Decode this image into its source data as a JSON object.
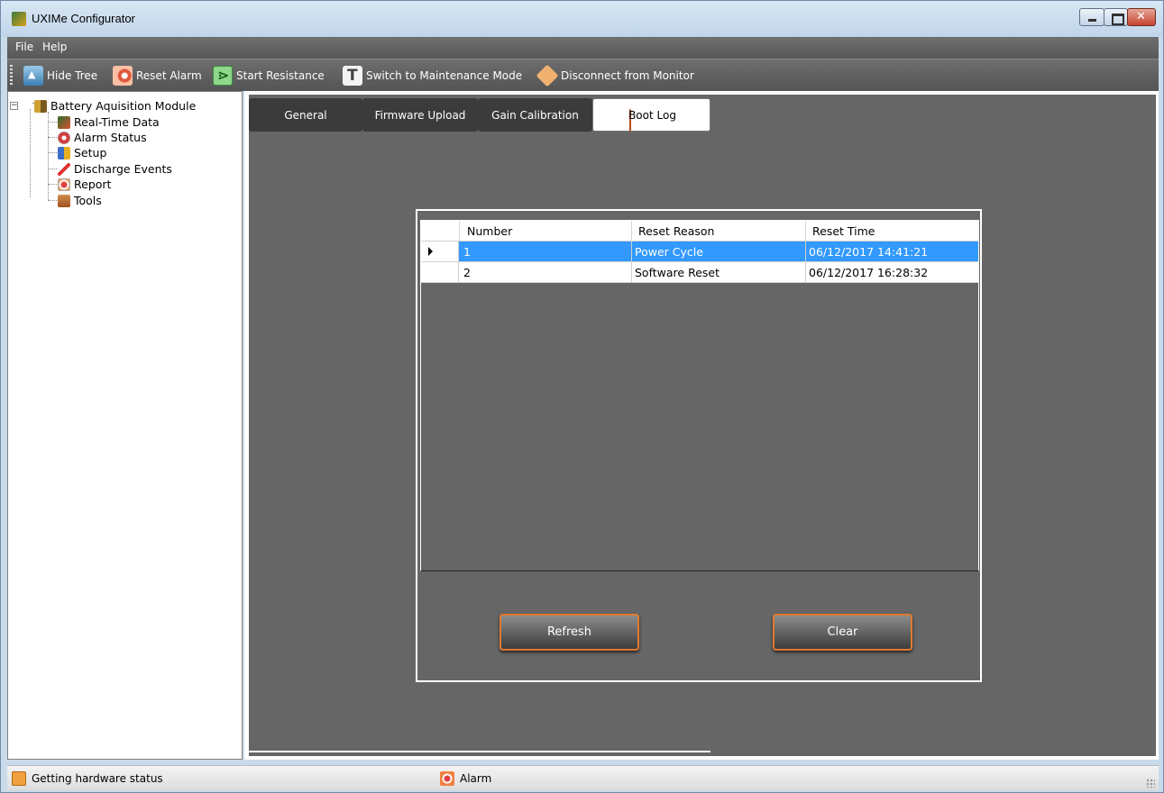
{
  "window": {
    "title": "UXIMe Configurator"
  },
  "menu": {
    "items": [
      "File",
      "Help"
    ]
  },
  "toolbar": {
    "hide_tree": "Hide Tree",
    "reset_alarm": "Reset Alarm",
    "start_resistance": "Start Resistance",
    "maintenance": "Switch to Maintenance Mode",
    "disconnect": "Disconnect from Monitor"
  },
  "tree": {
    "root": "Battery Aquisition Module",
    "children": [
      "Real-Time Data",
      "Alarm Status",
      "Setup",
      "Discharge Events",
      "Report",
      "Tools"
    ]
  },
  "tabs": [
    {
      "label": "General",
      "active": false
    },
    {
      "label": "Firmware Upload",
      "active": false
    },
    {
      "label": "Gain Calibration",
      "active": false
    },
    {
      "label": "Boot Log",
      "active": true
    }
  ],
  "boot_log": {
    "columns": [
      "Number",
      "Reset Reason",
      "Reset Time"
    ],
    "rows": [
      {
        "number": "1",
        "reason": "Power Cycle",
        "time": "06/12/2017 14:41:21",
        "selected": true
      },
      {
        "number": "2",
        "reason": "Software Reset",
        "time": "06/12/2017 16:28:32",
        "selected": false
      }
    ],
    "refresh_label": "Refresh",
    "clear_label": "Clear"
  },
  "status": {
    "message": "Getting hardware status",
    "alarm": "Alarm"
  },
  "colors": {
    "accent": "#e07a30",
    "selection": "#3399ff",
    "panel_bg": "#666666"
  }
}
